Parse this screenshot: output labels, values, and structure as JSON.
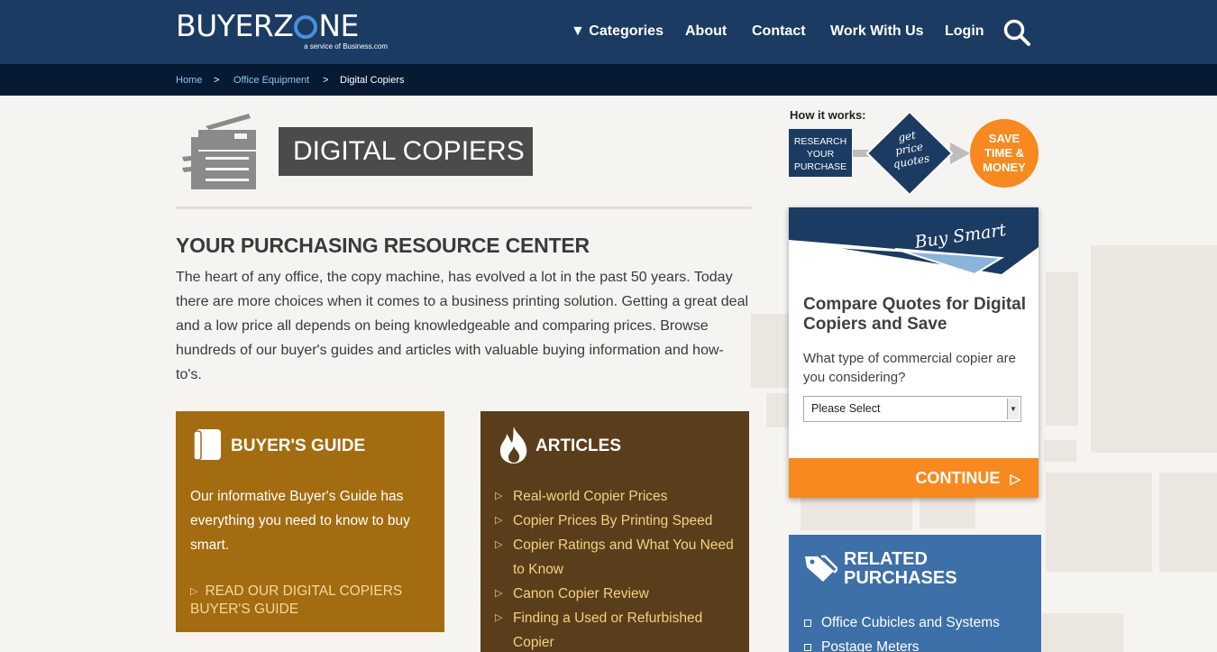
{
  "header": {
    "logo_text": "BUYERZONE",
    "logo_tagline": "a service of Business.com",
    "nav": {
      "categories": "▼ Categories",
      "about": "About",
      "contact": "Contact",
      "work_with_us": "Work With Us",
      "login": "Login"
    }
  },
  "breadcrumb": {
    "home": "Home",
    "sep1": ">",
    "office_equipment": "Office Equipment",
    "sep2": ">",
    "current": "Digital Copiers"
  },
  "page": {
    "title": "DIGITAL COPIERS",
    "section_heading": "YOUR PURCHASING RESOURCE CENTER",
    "intro": "The heart of any office, the copy machine, has evolved a lot in the past 50 years. Today there are more choices when it comes to a business printing solution. Getting a great deal and a low price all depends on being knowledgeable and comparing prices. Browse hundreds of our buyer's guides and articles with valuable buying information and how-to's."
  },
  "buyers_guide": {
    "heading": "BUYER'S GUIDE",
    "text": "Our informative Buyer's Guide has everything you need to know to buy smart.",
    "link": "READ OUR DIGITAL COPIERS BUYER'S GUIDE"
  },
  "articles": {
    "heading": "ARTICLES",
    "items": [
      "Real-world Copier Prices",
      "Copier Prices By Printing Speed",
      "Copier Ratings and What You Need to Know",
      "Canon Copier Review",
      "Finding a Used or Refurbished Copier"
    ]
  },
  "how_it_works": {
    "label": "How it works:",
    "step1": [
      "RESEARCH",
      "YOUR",
      "PURCHASE"
    ],
    "step2": [
      "get",
      "price",
      "quotes"
    ],
    "step3": [
      "SAVE",
      "TIME &",
      "MONEY"
    ]
  },
  "widget": {
    "banner": "Buy Smart",
    "title": "Compare Quotes for Digital Copiers and Save",
    "question": "What type of commercial copier are you considering?",
    "select_value": "Please Select",
    "button": "CONTINUE"
  },
  "related": {
    "heading_line1": "RELATED",
    "heading_line2": "PURCHASES",
    "items": [
      "Office Cubicles and Systems",
      "Postage Meters"
    ]
  },
  "colors": {
    "header_bg": "#1c3b63",
    "breadcrumb_bg": "#061a33",
    "guide_bg": "#a36c10",
    "articles_bg": "#5a3e1b",
    "accent_orange": "#f7891f",
    "related_bg": "#3d6fa8"
  }
}
